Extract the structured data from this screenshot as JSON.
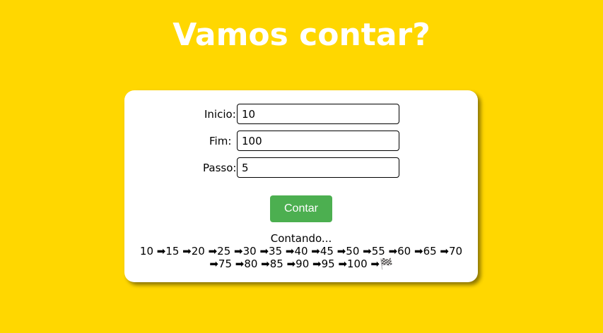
{
  "page": {
    "title": "Vamos contar?",
    "background_color": "#FFD700"
  },
  "form": {
    "inicio": {
      "label": "Inicio:",
      "value": "10"
    },
    "fim": {
      "label": "Fim:",
      "value": "100"
    },
    "passo": {
      "label": "Passo:",
      "value": "5"
    },
    "submit_label": "Contar",
    "button_color": "#4CAF50"
  },
  "result": {
    "heading": "Contando...",
    "line1": "10 ➡15 ➡20 ➡25 ➡30 ➡35 ➡40 ➡45 ➡50 ➡55 ➡60 ➡65 ➡70",
    "line2": "➡75 ➡80 ➡85 ➡90 ➡95 ➡100 ➡🏁"
  }
}
